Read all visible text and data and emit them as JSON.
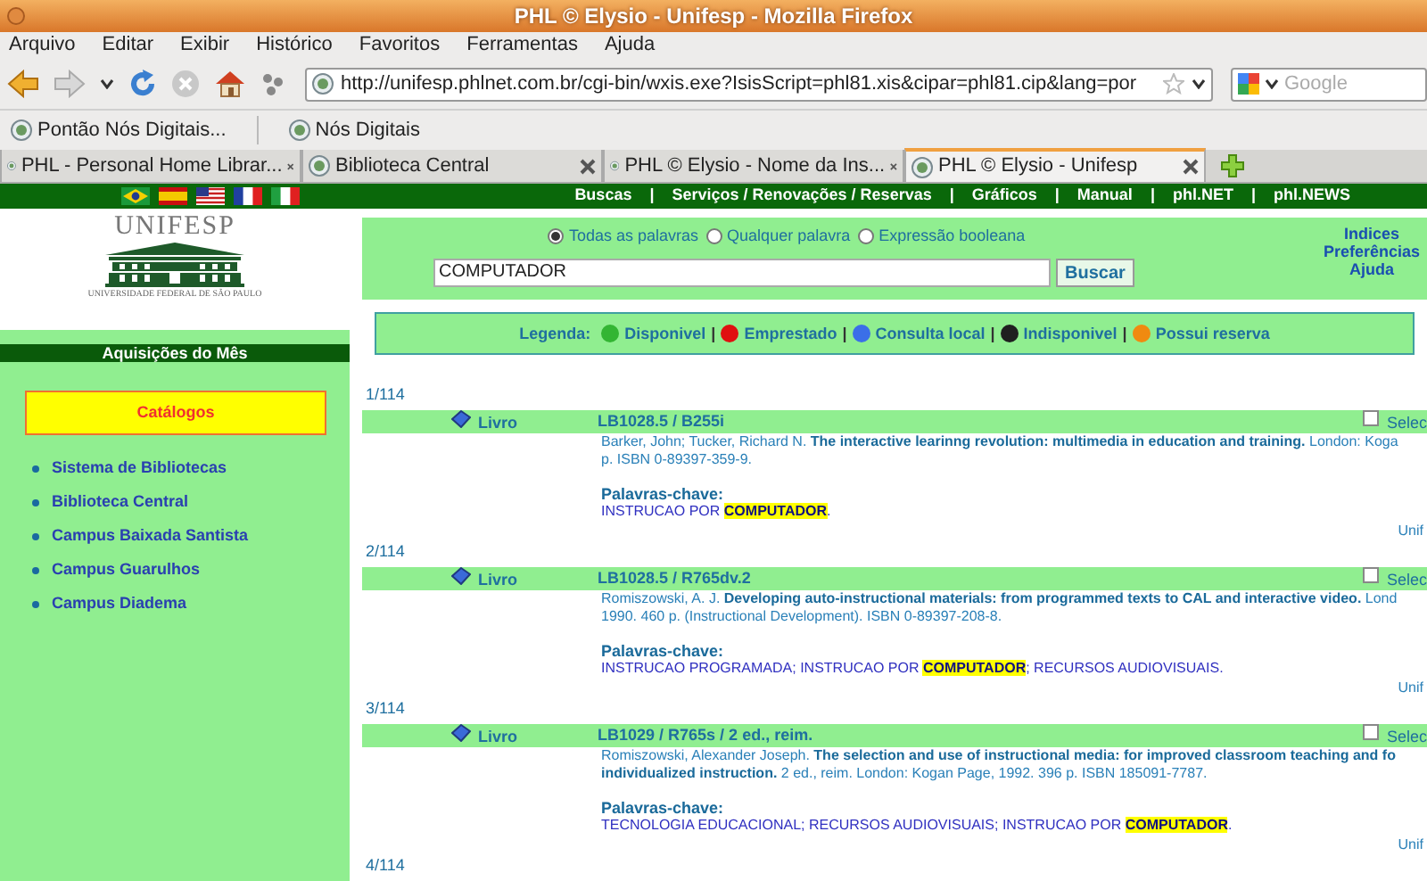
{
  "window": {
    "title": "PHL © Elysio - Unifesp - Mozilla Firefox"
  },
  "menu": [
    "Arquivo",
    "Editar",
    "Exibir",
    "Histórico",
    "Favoritos",
    "Ferramentas",
    "Ajuda"
  ],
  "address_bar": {
    "value": "http://unifesp.phlnet.com.br/cgi-bin/wxis.exe?IsisScript=phl81.xis&cipar=phl81.cip&lang=por"
  },
  "search_bar": {
    "placeholder": "Google"
  },
  "bookmarks": [
    "Pontão Nós Digitais...",
    "Nós Digitais"
  ],
  "tabs": [
    {
      "label": "PHL - Personal Home Librar...",
      "selected": false
    },
    {
      "label": "Biblioteca Central",
      "selected": false
    },
    {
      "label": "PHL © Elysio - Nome da Ins...",
      "selected": false
    },
    {
      "label": "PHL © Elysio - Unifesp",
      "selected": true
    }
  ],
  "site_nav": {
    "links": [
      "Buscas",
      "Serviços / Renovações / Reservas",
      "Gráficos",
      "Manual",
      "phl.NET",
      "phl.NEWS"
    ],
    "separators": [
      "|",
      "|",
      "|",
      "|",
      "|"
    ]
  },
  "sidebar": {
    "logo_name": "UNIFESP",
    "logo_subtitle": "UNIVERSIDADE FEDERAL DE SÃO PAULO",
    "heading": "Aquisições do Mês",
    "catalog_box": "Catálogos",
    "links": [
      "Sistema de Bibliotecas",
      "Biblioteca Central",
      "Campus Baixada Santista",
      "Campus Guarulhos",
      "Campus Diadema"
    ]
  },
  "search": {
    "options": [
      {
        "label": "Todas as palavras",
        "selected": true
      },
      {
        "label": "Qualquer palavra",
        "selected": false
      },
      {
        "label": "Expressão booleana",
        "selected": false
      }
    ],
    "query": {
      "value": "COMPUTADOR"
    },
    "button": "Buscar",
    "links": [
      "Indices",
      "Preferências",
      "Ajuda"
    ]
  },
  "legend": {
    "label": "Legenda:",
    "items": [
      {
        "label": "Disponivel",
        "color": "#33b533"
      },
      {
        "label": "Emprestado",
        "color": "#e01010"
      },
      {
        "label": "Consulta local",
        "color": "#3b6fe8"
      },
      {
        "label": "Indisponivel",
        "color": "#202020"
      },
      {
        "label": "Possui reserva",
        "color": "#f08a10"
      }
    ],
    "separators": [
      "|",
      "|",
      "|",
      "|"
    ]
  },
  "results": [
    {
      "position": "1/114",
      "type": "Livro",
      "call_number": "LB1028.5 / B255i",
      "checked": false,
      "checkbox_label": "Selec",
      "lines": [
        "Barker, John; Tucker, Richard N. **The interactive learinng revolution: multimedia in education and training.** London: Koga",
        "p. ISBN 0-89397-359-9."
      ],
      "keywords_label": "Palavras-chave:",
      "keywords": "INSTRUCAO POR **COMPUTADOR**.",
      "library": "Unif"
    },
    {
      "position": "2/114",
      "type": "Livro",
      "call_number": "LB1028.5 / R765dv.2",
      "checked": false,
      "checkbox_label": "Selec",
      "lines": [
        "Romiszowski, A. J. **Developing auto-instructional materials: from programmed texts to CAL and interactive video.** Lond",
        "1990. 460 p. (Instructional Development). ISBN 0-89397-208-8."
      ],
      "keywords_label": "Palavras-chave:",
      "keywords": "INSTRUCAO PROGRAMADA; INSTRUCAO POR **COMPUTADOR**; RECURSOS AUDIOVISUAIS.",
      "library": "Unif"
    },
    {
      "position": "3/114",
      "type": "Livro",
      "call_number": "LB1029 / R765s / 2 ed., reim.",
      "checked": false,
      "checkbox_label": "Selec",
      "lines": [
        "Romiszowski, Alexander Joseph. **The selection and use of instructional media: for improved classroom teaching and fo**",
        "**individualized instruction.** 2 ed., reim. London: Kogan Page, 1992. 396 p. ISBN 185091-7787."
      ],
      "keywords_label": "Palavras-chave:",
      "keywords": "TECNOLOGIA EDUCACIONAL; RECURSOS AUDIOVISUAIS; INSTRUCAO POR **COMPUTADOR**.",
      "library": "Unif"
    }
  ],
  "trailing_position": "4/114"
}
